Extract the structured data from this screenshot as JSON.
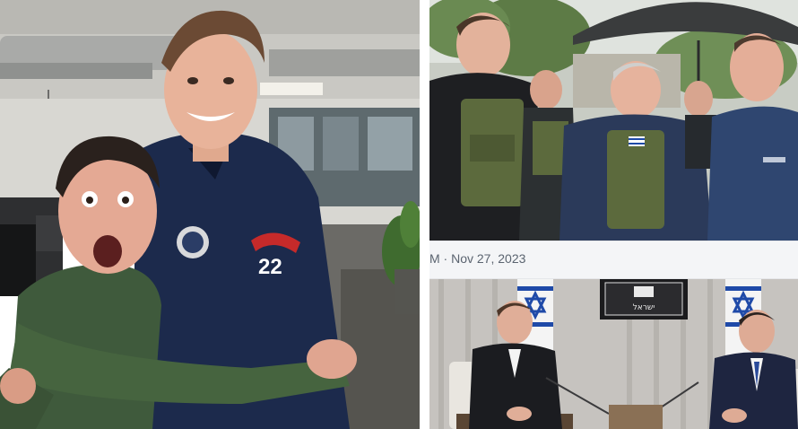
{
  "caption": {
    "text": "M · Nov 27, 2023"
  },
  "photos": {
    "left": {
      "jacket_patch_number": "22"
    },
    "top_right": {},
    "bottom_right": {
      "plaque_text": "ישראל"
    }
  },
  "colors": {
    "caption_text": "#5b6470",
    "caption_background": "#f4f5f7",
    "flag_blue": "#1f4aa8",
    "jacket_navy": "#1c2a4c",
    "shirt_green": "#3f5a3c",
    "vest_olive": "#5c6a3d"
  }
}
